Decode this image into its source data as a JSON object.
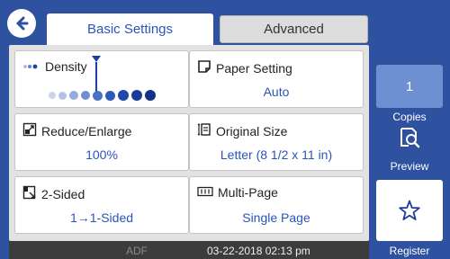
{
  "header": {
    "tabs": [
      {
        "label": "Basic Settings",
        "active": true
      },
      {
        "label": "Advanced",
        "active": false
      }
    ]
  },
  "tiles": {
    "density": {
      "label": "Density",
      "icon": "density-icon"
    },
    "paper_setting": {
      "label": "Paper Setting",
      "value": "Auto",
      "icon": "paper-icon"
    },
    "reduce_enlarge": {
      "label": "Reduce/Enlarge",
      "value": "100%",
      "icon": "resize-icon"
    },
    "original_size": {
      "label": "Original Size",
      "value": "Letter (8 1/2 x 11 in)",
      "icon": "original-size-icon"
    },
    "two_sided": {
      "label": "2-Sided",
      "value": "1→1-Sided",
      "icon": "two-sided-icon"
    },
    "multi_page": {
      "label": "Multi-Page",
      "value": "Single Page",
      "icon": "multi-page-icon"
    }
  },
  "status_bar": {
    "adf": "ADF",
    "datetime": "03-22-2018 02:13 pm"
  },
  "side": {
    "copies_value": "1",
    "copies_label": "Copies",
    "preview_label": "Preview",
    "register_label": "Register"
  },
  "colors": {
    "background": "#2f52a0",
    "accent_text": "#2a55b8",
    "copies_box": "#6e8fd2",
    "status_bar": "#3c3c3c"
  }
}
